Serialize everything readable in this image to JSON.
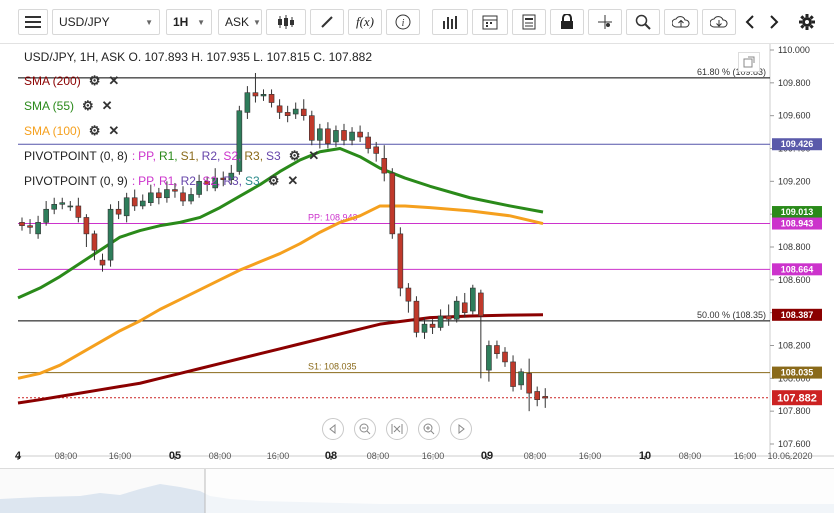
{
  "toolbar": {
    "symbol": "USD/JPY",
    "timeframe": "1H",
    "price_type": "ASK",
    "formula_label": "f(x)"
  },
  "header": {
    "ohlc": "USD/JPY, 1H, ASK   O. 107.893 H. 107.935 L. 107.815 C. 107.882"
  },
  "legend": [
    {
      "label": "SMA (200)",
      "color": "#8b0000"
    },
    {
      "label": "SMA (55)",
      "color": "#2a8a1a"
    },
    {
      "label": "SMA (100)",
      "color": "#f5a01e"
    },
    {
      "label": "PIVOTPOINT (0, 8)",
      "pivots": [
        "PP",
        "R1",
        "S1",
        "R2",
        "S2",
        "R3",
        "S3"
      ],
      "pivot_colors": [
        "#cc33cc",
        "#2a8a1a",
        "#8a6a1a",
        "#6644aa",
        "#cc33cc",
        "#8a6a1a",
        "#6644aa"
      ]
    },
    {
      "label": "PIVOTPOINT (0, 9)",
      "pivots": [
        "PP",
        "R1",
        "R2",
        "S2",
        "R3",
        "S3"
      ],
      "pivot_colors": [
        "#cc33cc",
        "#cc33cc",
        "#6644aa",
        "#cc33cc",
        "#6644aa",
        "#2a8a8a"
      ]
    }
  ],
  "chart_data": {
    "type": "candlestick",
    "instrument": "USD/JPY",
    "timeframe": "1H",
    "y_range": [
      107.6,
      110.0
    ],
    "y_ticks": [
      "110.000",
      "109.800",
      "109.600",
      "109.400",
      "109.200",
      "109.000",
      "108.800",
      "108.600",
      "108.400",
      "108.200",
      "108.000",
      "107.800",
      "107.600"
    ],
    "x_ticks": [
      "4",
      "08:00",
      "16:00",
      "05",
      "08:00",
      "16:00",
      "08",
      "08:00",
      "16:00",
      "09",
      "08:00",
      "16:00",
      "10",
      "08:00",
      "16:00",
      "10.06.2020"
    ],
    "x_tick_bold": [
      true,
      false,
      false,
      true,
      false,
      false,
      true,
      false,
      false,
      true,
      false,
      false,
      true,
      false,
      false,
      false
    ],
    "h_lines": [
      {
        "price": 109.83,
        "color": "#000000",
        "label": "61.80 % (109.83)",
        "label_side": "right"
      },
      {
        "price": 109.426,
        "color": "#5555aa",
        "label": "",
        "label_side": "none"
      },
      {
        "price": 108.943,
        "color": "#cc33cc",
        "label": "PP: 108.943",
        "label_side": "left"
      },
      {
        "price": 108.664,
        "color": "#cc33cc",
        "label": "",
        "label_side": "none"
      },
      {
        "price": 108.35,
        "color": "#000000",
        "label": "50.00 % (108.35)",
        "label_side": "right"
      },
      {
        "price": 108.035,
        "color": "#8a6a1a",
        "label": "S1: 108.035",
        "label_side": "left"
      }
    ],
    "price_tags": [
      {
        "price": 109.426,
        "text": "109.426",
        "color": "#5a5aaa"
      },
      {
        "price": 109.013,
        "text": "109.013",
        "color": "#2a8a1a"
      },
      {
        "price": 108.943,
        "text": "108.943",
        "color": "#cc33cc"
      },
      {
        "price": 108.664,
        "text": "108.664",
        "color": "#cc33cc"
      },
      {
        "price": 108.387,
        "text": "108.387",
        "color": "#8b0000"
      },
      {
        "price": 108.035,
        "text": "108.035",
        "color": "#8a6a1a"
      },
      {
        "price": 107.882,
        "text": "107.882",
        "color": "#cc2222"
      }
    ],
    "current_price": 107.882,
    "candles": [
      [
        108.95,
        108.93,
        108.98,
        108.9
      ],
      [
        108.93,
        108.92,
        108.97,
        108.88
      ],
      [
        108.88,
        108.95,
        108.99,
        108.85
      ],
      [
        108.95,
        109.03,
        109.08,
        108.93
      ],
      [
        109.03,
        109.06,
        109.1,
        109.0
      ],
      [
        109.06,
        109.07,
        109.1,
        109.03
      ],
      [
        109.05,
        109.05,
        109.08,
        109.02
      ],
      [
        109.05,
        108.98,
        109.1,
        108.95
      ],
      [
        108.98,
        108.88,
        109.0,
        108.8
      ],
      [
        108.88,
        108.78,
        108.9,
        108.72
      ],
      [
        108.72,
        108.69,
        108.76,
        108.65
      ],
      [
        108.72,
        109.03,
        109.06,
        108.68
      ],
      [
        109.03,
        109.0,
        109.08,
        108.97
      ],
      [
        108.99,
        109.1,
        109.13,
        108.95
      ],
      [
        109.1,
        109.05,
        109.15,
        109.02
      ],
      [
        109.05,
        109.08,
        109.12,
        109.03
      ],
      [
        109.07,
        109.13,
        109.18,
        109.05
      ],
      [
        109.13,
        109.1,
        109.16,
        109.06
      ],
      [
        109.1,
        109.15,
        109.2,
        109.07
      ],
      [
        109.15,
        109.14,
        109.19,
        109.1
      ],
      [
        109.13,
        109.08,
        109.17,
        109.05
      ],
      [
        109.08,
        109.12,
        109.16,
        109.06
      ],
      [
        109.12,
        109.2,
        109.24,
        109.1
      ],
      [
        109.2,
        109.18,
        109.23,
        109.14
      ],
      [
        109.16,
        109.22,
        109.28,
        109.14
      ],
      [
        109.22,
        109.21,
        109.26,
        109.17
      ],
      [
        109.21,
        109.25,
        109.3,
        109.18
      ],
      [
        109.26,
        109.63,
        109.66,
        109.24
      ],
      [
        109.62,
        109.74,
        109.78,
        109.58
      ],
      [
        109.74,
        109.72,
        109.86,
        109.68
      ],
      [
        109.72,
        109.73,
        109.76,
        109.69
      ],
      [
        109.73,
        109.68,
        109.76,
        109.65
      ],
      [
        109.66,
        109.62,
        109.7,
        109.58
      ],
      [
        109.62,
        109.6,
        109.66,
        109.56
      ],
      [
        109.61,
        109.64,
        109.68,
        109.58
      ],
      [
        109.64,
        109.6,
        109.7,
        109.57
      ],
      [
        109.6,
        109.45,
        109.63,
        109.42
      ],
      [
        109.45,
        109.52,
        109.55,
        109.4
      ],
      [
        109.52,
        109.43,
        109.56,
        109.4
      ],
      [
        109.44,
        109.51,
        109.54,
        109.41
      ],
      [
        109.51,
        109.45,
        109.55,
        109.42
      ],
      [
        109.45,
        109.5,
        109.53,
        109.42
      ],
      [
        109.5,
        109.47,
        109.54,
        109.44
      ],
      [
        109.47,
        109.4,
        109.5,
        109.37
      ],
      [
        109.41,
        109.37,
        109.44,
        109.32
      ],
      [
        109.34,
        109.25,
        109.42,
        109.2
      ],
      [
        109.25,
        108.88,
        109.28,
        108.85
      ],
      [
        108.88,
        108.55,
        108.92,
        108.5
      ],
      [
        108.55,
        108.47,
        108.58,
        108.4
      ],
      [
        108.47,
        108.28,
        108.5,
        108.25
      ],
      [
        108.28,
        108.33,
        108.37,
        108.24
      ],
      [
        108.33,
        108.31,
        108.36,
        108.27
      ],
      [
        108.31,
        108.38,
        108.42,
        108.29
      ],
      [
        108.38,
        108.36,
        108.45,
        108.32
      ],
      [
        108.36,
        108.47,
        108.5,
        108.34
      ],
      [
        108.46,
        108.4,
        108.52,
        108.37
      ],
      [
        108.41,
        108.55,
        108.57,
        108.39
      ],
      [
        108.52,
        108.38,
        108.54,
        108.0
      ],
      [
        108.05,
        108.2,
        108.23,
        107.98
      ],
      [
        108.2,
        108.15,
        108.23,
        108.12
      ],
      [
        108.16,
        108.1,
        108.19,
        108.07
      ],
      [
        108.1,
        107.95,
        108.14,
        107.92
      ],
      [
        107.96,
        108.04,
        108.06,
        107.93
      ],
      [
        108.03,
        107.91,
        108.12,
        107.8
      ],
      [
        107.92,
        107.87,
        107.95,
        107.83
      ],
      [
        107.89,
        107.88,
        107.94,
        107.82
      ]
    ],
    "sma200": [
      107.85,
      107.87,
      107.89,
      107.91,
      107.93,
      107.95,
      107.97,
      108.0,
      108.03,
      108.06,
      108.09,
      108.12,
      108.15,
      108.18,
      108.21,
      108.24,
      108.27,
      108.3,
      108.33,
      108.35,
      108.37,
      108.38,
      108.385,
      108.387
    ],
    "sma55": [
      108.49,
      108.55,
      108.62,
      108.7,
      108.78,
      108.86,
      108.9,
      108.93,
      108.95,
      108.98,
      109.04,
      109.11,
      109.18,
      109.26,
      109.33,
      109.38,
      109.4,
      109.35,
      109.28,
      109.22,
      109.17,
      109.1,
      109.05,
      109.013
    ],
    "sma100": [
      108.0,
      108.03,
      108.08,
      108.15,
      108.22,
      108.29,
      108.35,
      108.42,
      108.48,
      108.54,
      108.6,
      108.66,
      108.71,
      108.76,
      108.82,
      108.89,
      108.95,
      108.99,
      109.05,
      109.05,
      109.04,
      109.02,
      108.99,
      108.943
    ],
    "sma_x_positions": [
      18,
      40,
      60,
      80,
      100,
      120,
      140,
      160,
      180,
      200,
      220,
      240,
      260,
      280,
      300,
      320,
      340,
      360,
      380,
      405,
      430,
      470,
      510,
      543
    ]
  }
}
